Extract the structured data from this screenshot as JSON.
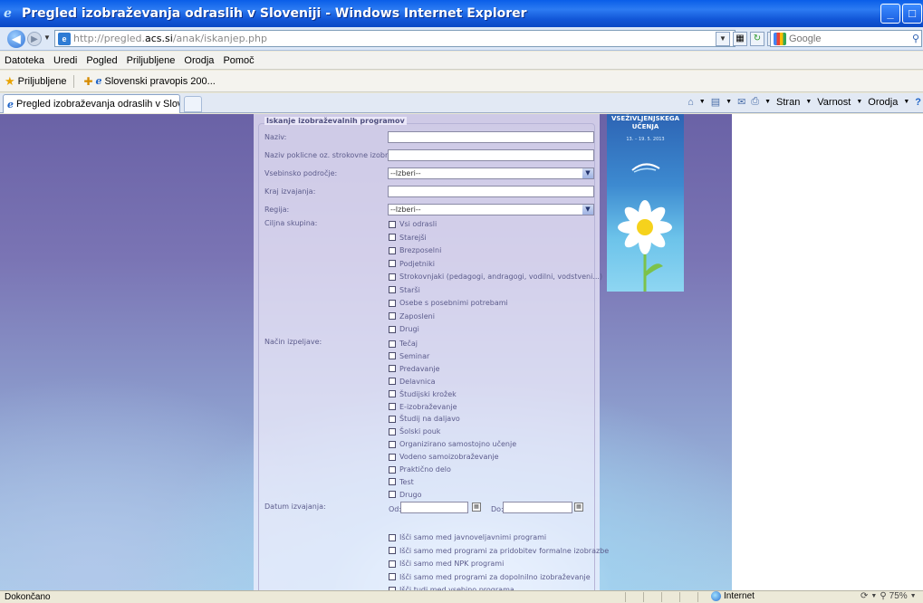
{
  "window": {
    "title": "Pregled izobraževanja odraslih v Sloveniji - Windows Internet Explorer"
  },
  "address": {
    "url_prefix": "http://pregled.",
    "url_domain": "acs.si",
    "url_suffix": "/anak/iskanjep.php",
    "search_placeholder": "Google"
  },
  "menu": [
    "Datoteka",
    "Uredi",
    "Pogled",
    "Priljubljene",
    "Orodja",
    "Pomoč"
  ],
  "favorites": {
    "label": "Priljubljene",
    "item": "Slovenski pravopis 200..."
  },
  "tab": {
    "title": "Pregled izobraževanja odraslih v Sloveniji"
  },
  "commandbar": {
    "stran": "Stran",
    "varnost": "Varnost",
    "orodja": "Orodja"
  },
  "form": {
    "legend": "Iskanje izobraževalnih programov",
    "naziv": "Naziv:",
    "naziv_poklicne": "Naziv poklicne oz. strokovne izobrazbe:",
    "vsebinsko": "Vsebinsko področje:",
    "vsebinsko_value": "--Izberi--",
    "kraj": "Kraj izvajanja:",
    "regija": "Regija:",
    "regija_value": "--Izberi--",
    "ciljna": "Ciljna skupina:",
    "ciljna_items": [
      "Vsi odrasli",
      "Starejši",
      "Brezposelni",
      "Podjetniki",
      "Strokovnjaki (pedagogi, andragogi, vodilni, vodstveni...)",
      "Starši",
      "Osebe s posebnimi potrebami",
      "Zaposleni",
      "Drugi"
    ],
    "nacin": "Način izpeljave:",
    "nacin_items": [
      "Tečaj",
      "Seminar",
      "Predavanje",
      "Delavnica",
      "Študijski krožek",
      "E-izobraževanje",
      "Študij na daljavo",
      "Šolski pouk",
      "Organizirano samostojno učenje",
      "Vodeno samoizobraževanje",
      "Praktično delo",
      "Test",
      "Drugo"
    ],
    "datum": "Datum izvajanja:",
    "od": "Od:",
    "do": "Do:",
    "filters": [
      "Išči samo med javnoveljavnimi programi",
      "Išči samo med programi za pridobitev formalne izobrazbe",
      "Išči samo med NPK programi",
      "Išči samo med programi za dopolnilno izobraževanje",
      "Išči tudi med vsebino programa"
    ]
  },
  "banner": {
    "title": "VSEŽIVLJENJSKEGA UČENJA",
    "dates": "13. – 19. 5. 2013"
  },
  "status": {
    "text": "Dokončano",
    "zone": "Internet",
    "zoom": "75%"
  }
}
